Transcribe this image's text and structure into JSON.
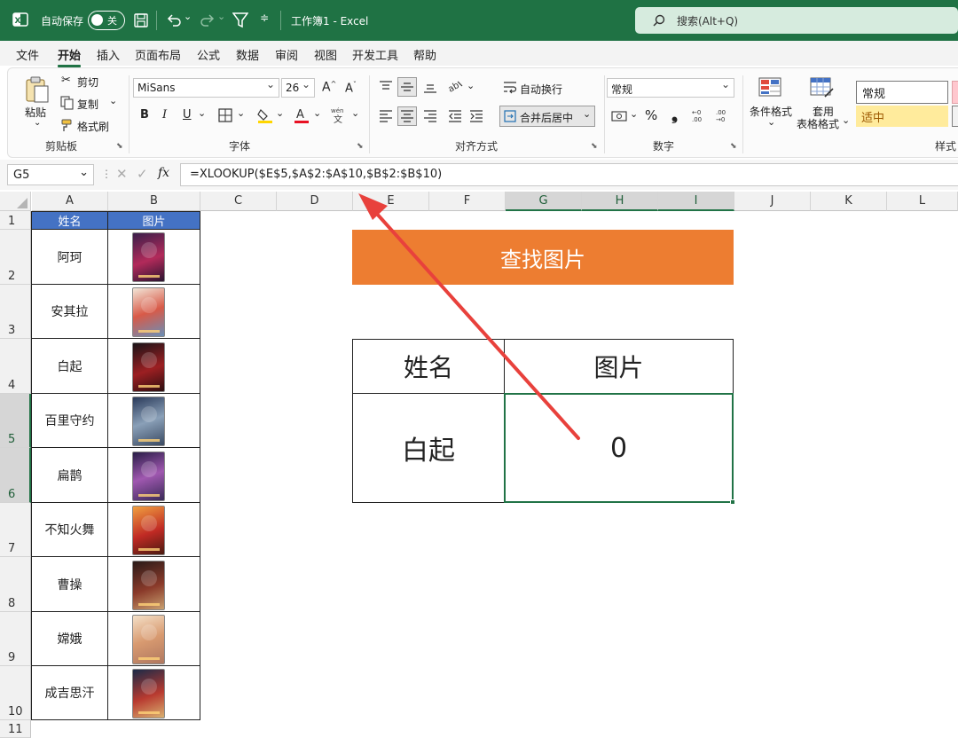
{
  "titlebar": {
    "autosave": "自动保存",
    "toggle_state": "关",
    "workbook_title": "工作簿1 - Excel",
    "search_placeholder": "搜索(Alt+Q)"
  },
  "menu": [
    "文件",
    "开始",
    "插入",
    "页面布局",
    "公式",
    "数据",
    "审阅",
    "视图",
    "开发工具",
    "帮助"
  ],
  "ribbon": {
    "paste": "粘贴",
    "cut": "剪切",
    "copy": "复制",
    "format_painter": "格式刷",
    "clipboard_group": "剪贴板",
    "font_name": "MiSans",
    "font_size": "26",
    "font_group": "字体",
    "bold": "B",
    "italic": "I",
    "underline": "U",
    "wrap_text": "自动换行",
    "merge_center": "合并后居中",
    "align_group": "对齐方式",
    "number_format": "常规",
    "number_group": "数字",
    "percent": "%",
    "comma": "❟",
    "cond_format": "条件格式",
    "table_format_1": "套用",
    "table_format_2": "表格格式",
    "style_normal": "常规",
    "style_neutral": "适中",
    "styles_group": "样式"
  },
  "formula_bar": {
    "name_box": "G5",
    "fx": "fx",
    "formula": "=XLOOKUP($E$5,$A$2:$A$10,$B$2:$B$10)"
  },
  "columns": [
    "A",
    "B",
    "C",
    "D",
    "E",
    "F",
    "G",
    "H",
    "I",
    "J",
    "K",
    "L"
  ],
  "rows": [
    "1",
    "2",
    "3",
    "4",
    "5",
    "6",
    "7",
    "8",
    "9",
    "10",
    "11"
  ],
  "table": {
    "header_name": "姓名",
    "header_image": "图片",
    "names": [
      "阿珂",
      "安其拉",
      "白起",
      "百里守约",
      "扁鹊",
      "不知火舞",
      "曹操",
      "嫦娥",
      "成吉思汗"
    ]
  },
  "lookup": {
    "title": "查找图片",
    "header_name": "姓名",
    "header_image": "图片",
    "name_value": "白起",
    "image_value": "0"
  },
  "colors": {
    "excel_green": "#1f7244",
    "header_blue": "#4472c4",
    "title_orange": "#ed7d31",
    "arrow_red": "#e8413c",
    "selection_green": "#217346"
  }
}
